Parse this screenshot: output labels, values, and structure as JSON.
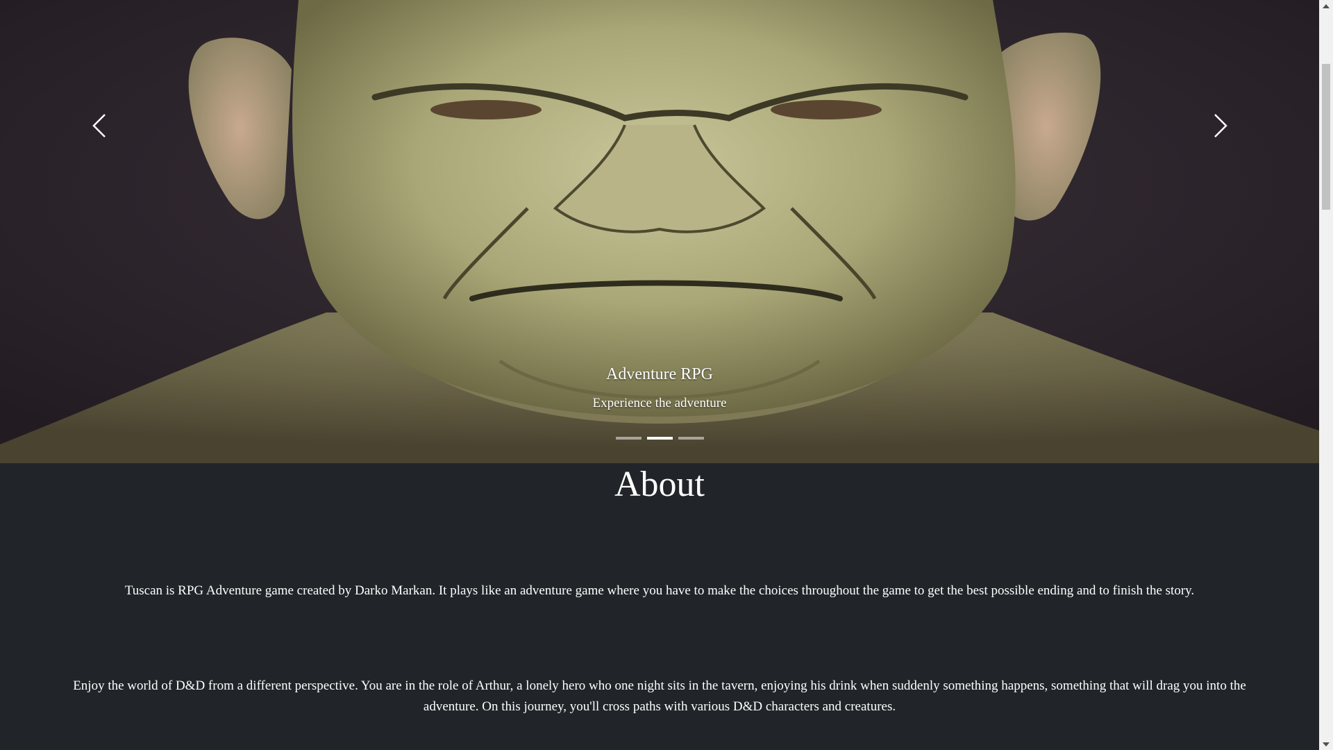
{
  "carousel": {
    "slide": {
      "title": "Adventure RPG",
      "subtitle": "Experience the adventure",
      "image_subject": "green-skinned bald orc face portrait"
    },
    "controls": {
      "prev_icon": "chevron-left-icon",
      "next_icon": "chevron-right-icon"
    },
    "indicators": {
      "count": 3,
      "active_index": 1
    }
  },
  "about": {
    "title": "About",
    "paragraphs": [
      "Tuscan is RPG Adventure game created by Darko Markan. It plays like an adventure game where you have to make the choices throughout the game to get the best possible ending and to finish the story.",
      "Enjoy the world of D&D from a different perspective. You are in the role of Arthur, a lonely hero who one night sits in the tavern, enjoying his drink when suddenly something happens, something that will drag you into the adventure. On this journey, you'll cross paths with various D&D characters and creatures."
    ]
  },
  "colors": {
    "page_background": "#212529",
    "text": "#ffffff",
    "carousel_background": "#2c2530",
    "skin": "#b7b688",
    "scrollbar_track": "#f1f1f1",
    "scrollbar_thumb": "#c1c1c1"
  }
}
